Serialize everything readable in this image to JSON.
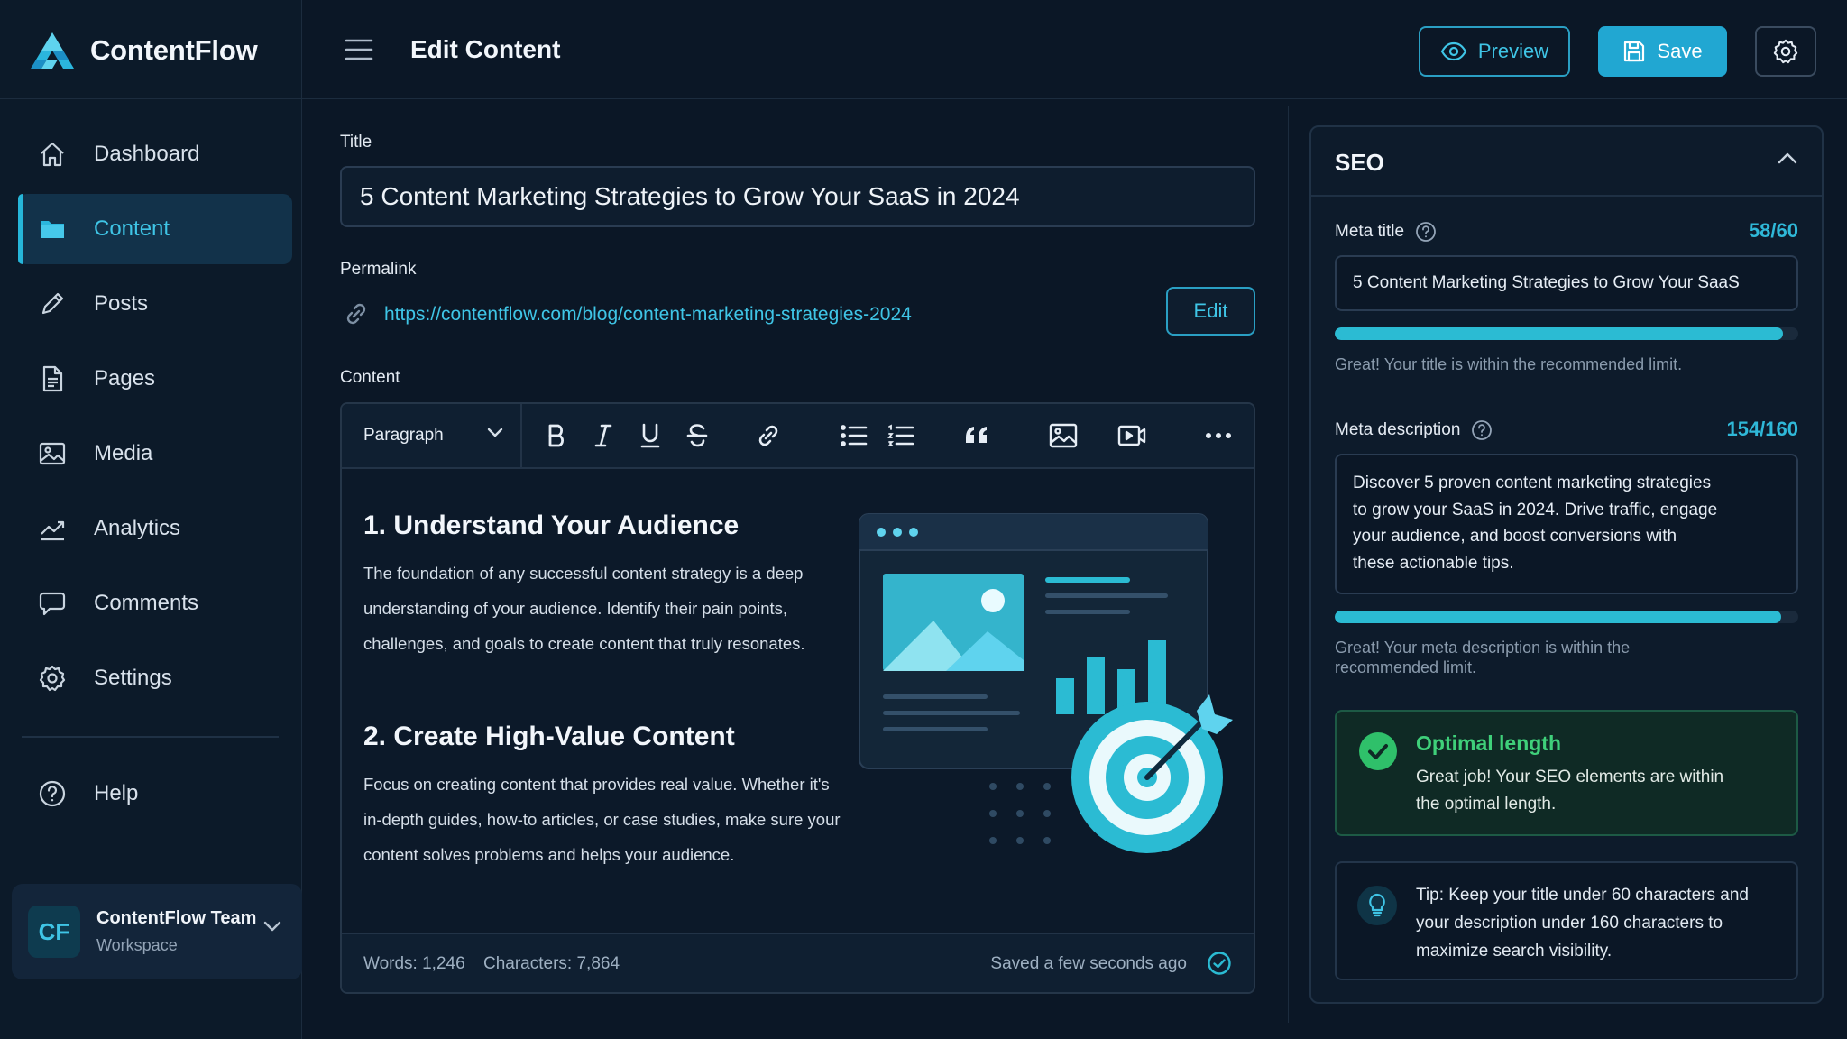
{
  "app": {
    "name": "ContentFlow"
  },
  "colors": {
    "accent": "#21a7d2",
    "success": "#3fd07a",
    "background": "#0b1726"
  },
  "sidebar": {
    "items": [
      {
        "label": "Dashboard",
        "icon": "home-icon"
      },
      {
        "label": "Content",
        "icon": "folder-icon",
        "active": true
      },
      {
        "label": "Posts",
        "icon": "pencil-icon"
      },
      {
        "label": "Pages",
        "icon": "document-icon"
      },
      {
        "label": "Media",
        "icon": "image-icon"
      },
      {
        "label": "Analytics",
        "icon": "chart-icon"
      },
      {
        "label": "Comments",
        "icon": "comment-icon"
      },
      {
        "label": "Settings",
        "icon": "gear-icon"
      }
    ],
    "help": {
      "label": "Help",
      "icon": "help-icon"
    },
    "workspace": {
      "initials": "CF",
      "name": "ContentFlow Team",
      "subtitle": "Workspace"
    }
  },
  "header": {
    "title": "Edit Content",
    "preview_label": "Preview",
    "save_label": "Save"
  },
  "editor": {
    "title_label": "Title",
    "title_value": "5 Content Marketing Strategies to Grow Your SaaS in 2024",
    "permalink_label": "Permalink",
    "permalink_url": "https://contentflow.com/blog/content-marketing-strategies-2024",
    "edit_label": "Edit",
    "content_label": "Content",
    "block_type": "Paragraph",
    "toolbar_icons": [
      "bold-icon",
      "italic-icon",
      "underline-icon",
      "strikethrough-icon",
      "link-icon",
      "bullet-list-icon",
      "numbered-list-icon",
      "quote-icon",
      "image-icon",
      "video-icon",
      "more-icon"
    ],
    "sections": [
      {
        "heading": "1. Understand Your Audience",
        "lines": [
          "The foundation of any successful content strategy is a deep",
          "understanding of your audience. Identify their pain points,",
          "challenges, and goals to create content that truly resonates."
        ]
      },
      {
        "heading": "2. Create High-Value Content",
        "lines": [
          "Focus on creating content that provides real value. Whether it's",
          "in-depth guides, how-to articles, or case studies, make sure your",
          "content solves problems and helps your audience."
        ]
      }
    ],
    "footer": {
      "words": "Words: 1,246",
      "characters": "Characters: 7,864",
      "saved": "Saved a few seconds ago"
    }
  },
  "seo": {
    "title": "SEO",
    "meta_title": {
      "label": "Meta title",
      "count": "58/60",
      "value": "5 Content Marketing Strategies to Grow Your SaaS",
      "progress": 0.967,
      "hint": "Great! Your title is within the recommended limit."
    },
    "meta_description": {
      "label": "Meta description",
      "count": "154/160",
      "lines": [
        "Discover 5 proven content marketing strategies",
        "to grow your SaaS in 2024. Drive traffic, engage",
        "your audience, and boost conversions with",
        "these actionable tips."
      ],
      "progress": 0.9625,
      "hint_lines": [
        "Great! Your meta description is within the",
        "recommended limit."
      ]
    },
    "optimal": {
      "title": "Optimal length",
      "lines": [
        "Great job! Your SEO elements are within",
        "the optimal length."
      ]
    },
    "tip": {
      "lines": [
        "Tip: Keep your title under 60 characters and",
        "your description under 160 characters to",
        "maximize search visibility."
      ]
    }
  }
}
